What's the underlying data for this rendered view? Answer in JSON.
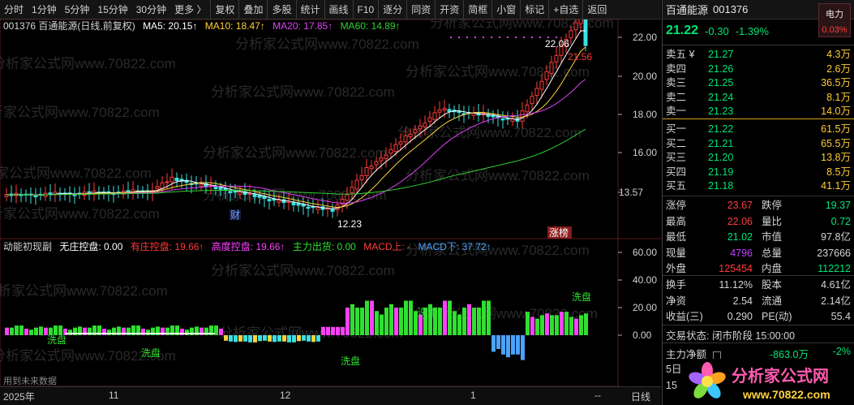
{
  "toolbar": {
    "items": [
      "分时",
      "1分钟",
      "5分钟",
      "15分钟",
      "30分钟",
      "更多 〉",
      "复权",
      "叠加",
      "多股",
      "统计",
      "画线",
      "F10",
      "逐分",
      "同资",
      "开资",
      "简框",
      "小窗",
      "标记",
      "+自选",
      "返回"
    ]
  },
  "main": {
    "legend": {
      "title": "001376 百通能源(日线,前复权)",
      "ma5": "MA5: 20.15↑",
      "ma10": "MA10: 18.47↑",
      "ma20": "MA20: 17.85↑",
      "ma60": "MA60: 14.89↑"
    },
    "price_axis": [
      "22.00",
      "20.00",
      "18.00",
      "16.00",
      "13.57"
    ],
    "annotations": {
      "high": "22.06",
      "low": "12.23",
      "last": "21.56",
      "tag_cai": "财",
      "tag_zhangting": "涨榜"
    },
    "watermark": "分析家公式网www.70822.com"
  },
  "sub": {
    "legend": {
      "name": "动能初现副",
      "wz": "无庄控盘: 0.00",
      "yz": "有庄控盘: 19.66↑",
      "gd": "高度控盘: 19.66↑",
      "zl": "主力出货: 0.00",
      "mu": "MACD上: -",
      "md": "MACD下: 37.72↑"
    },
    "axis": [
      "60.00",
      "40.00",
      "20.00",
      "0.00"
    ],
    "labels": [
      "洗盘",
      "洗盘",
      "洗盘",
      "洗盘",
      "洗盘"
    ],
    "footer": "用到未来数据"
  },
  "xaxis": {
    "labels": [
      "2025年",
      "11",
      "12",
      "1"
    ],
    "dash": "--",
    "tab": "日线"
  },
  "quote": {
    "name": "百通能源",
    "code": "001376",
    "sector": "电力",
    "sector_chg": "0.03%",
    "price": "21.22",
    "chg": "-0.30",
    "pct": "-1.39%",
    "sell": [
      {
        "label": "卖五 ¥",
        "price": "21.27",
        "vol": "4.3万"
      },
      {
        "label": "卖四",
        "price": "21.26",
        "vol": "2.6万"
      },
      {
        "label": "卖三",
        "price": "21.25",
        "vol": "36.5万"
      },
      {
        "label": "卖二",
        "price": "21.24",
        "vol": "8.1万"
      },
      {
        "label": "卖一",
        "price": "21.23",
        "vol": "14.0万"
      }
    ],
    "buy": [
      {
        "label": "买一",
        "price": "21.22",
        "vol": "61.5万"
      },
      {
        "label": "买二",
        "price": "21.21",
        "vol": "65.5万"
      },
      {
        "label": "买三",
        "price": "21.20",
        "vol": "13.8万"
      },
      {
        "label": "买四",
        "price": "21.19",
        "vol": "8.5万"
      },
      {
        "label": "买五",
        "price": "21.18",
        "vol": "41.1万"
      }
    ],
    "stats": [
      {
        "l1": "涨停",
        "v1": "23.67",
        "c1": "#ff3b3b",
        "l2": "跌停",
        "v2": "19.37",
        "c2": "#00e676"
      },
      {
        "l1": "最高",
        "v1": "22.06",
        "c1": "#ff3b3b",
        "l2": "量比",
        "v2": "0.72",
        "c2": "#00e676"
      },
      {
        "l1": "最低",
        "v1": "21.02",
        "c1": "#00e676",
        "l2": "市值",
        "v2": "97.8亿",
        "c2": "#d4d4d4"
      },
      {
        "l1": "现量",
        "v1": "4796",
        "c1": "#c040ff",
        "l2": "总量",
        "v2": "237666",
        "c2": "#d4d4d4"
      },
      {
        "l1": "外盘",
        "v1": "125454",
        "c1": "#ff3b3b",
        "l2": "内盘",
        "v2": "112212",
        "c2": "#00e676"
      }
    ],
    "stats2": [
      {
        "l1": "换手",
        "v1": "11.12%",
        "c1": "#d4d4d4",
        "l2": "股本",
        "v2": "4.61亿",
        "c2": "#d4d4d4"
      },
      {
        "l1": "净资",
        "v1": "2.54",
        "c1": "#d4d4d4",
        "l2": "流通",
        "v2": "2.14亿",
        "c2": "#d4d4d4"
      },
      {
        "l1": "收益(三)",
        "v1": "0.290",
        "c1": "#d4d4d4",
        "l2": "PE(动)",
        "v2": "55.4",
        "c2": "#d4d4d4"
      }
    ],
    "trade_status": "交易状态: 闭市阶段 15:00:00",
    "net_flow": {
      "label": "主力净额",
      "value": "-863.0万",
      "pct": "-2%"
    },
    "days5": "5日",
    "days15": "15"
  },
  "logo": {
    "text": "分析家公式网",
    "url_text": "www.70822.com"
  }
}
